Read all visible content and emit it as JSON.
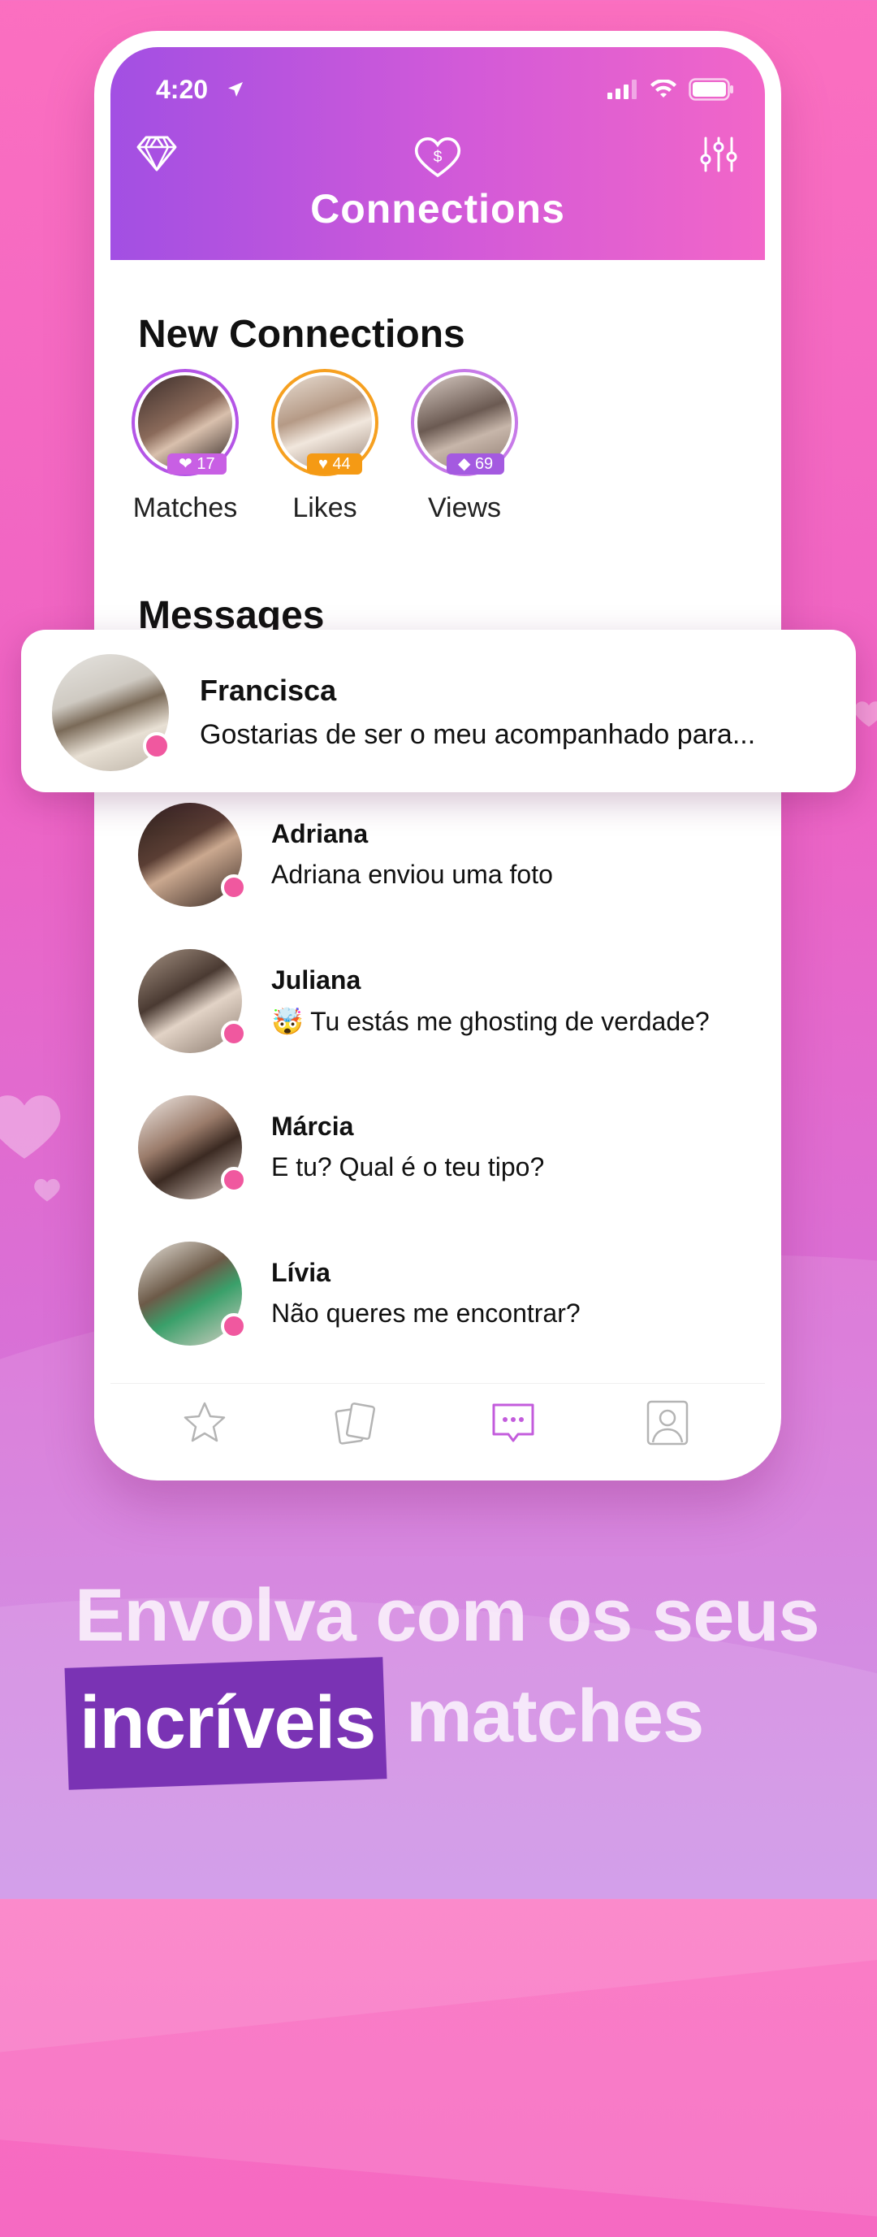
{
  "status_bar": {
    "time": "4:20"
  },
  "header": {
    "title": "Connections"
  },
  "new_connections": {
    "title": "New Connections",
    "items": [
      {
        "label": "Matches",
        "count": "17",
        "ring_color": "#b455e6",
        "badge_color": "#c85fe4"
      },
      {
        "label": "Likes",
        "count": "44",
        "ring_color": "#f6a020",
        "badge_color": "#f59a14"
      },
      {
        "label": "Views",
        "count": "69",
        "ring_color": "#c77ae8",
        "badge_color": "#a45ae0"
      }
    ]
  },
  "messages": {
    "title": "Messages",
    "featured": {
      "name": "Francisca",
      "text": "Gostarias de ser o meu acompanhado para..."
    },
    "items": [
      {
        "name": "Adriana",
        "text": "Adriana enviou uma foto"
      },
      {
        "name": "Juliana",
        "text": "🤯 Tu estás me ghosting de verdade?"
      },
      {
        "name": "Márcia",
        "text": "E tu? Qual é o teu tipo?"
      },
      {
        "name": "Lívia",
        "text": "Não queres me encontrar?"
      }
    ]
  },
  "tabbar": {
    "icons": [
      "star-icon",
      "cards-icon",
      "chat-icon",
      "profile-icon"
    ],
    "active_color": "#c35cdc"
  },
  "tagline": {
    "line1": "Envolva com os seus",
    "highlight": "incríveis",
    "line2_rest": "matches"
  }
}
